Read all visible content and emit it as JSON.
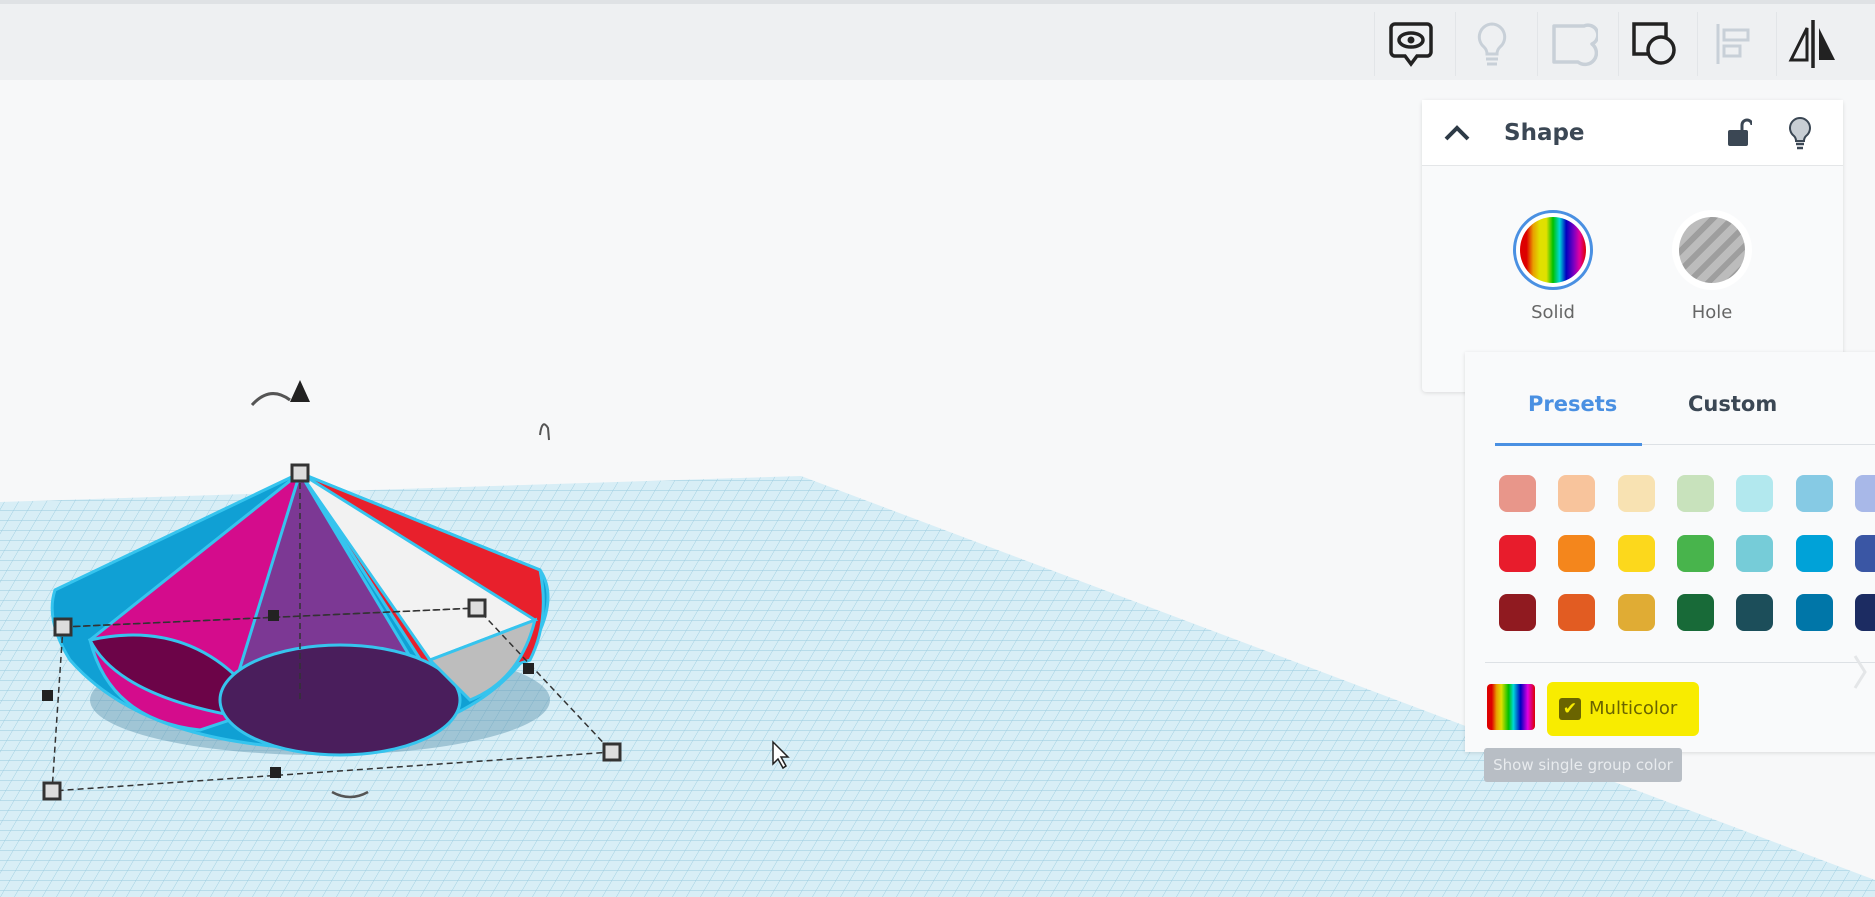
{
  "toolbar": {
    "items": [
      {
        "icon": "show-all-icon",
        "enabled": true
      },
      {
        "icon": "lightbulb-icon",
        "enabled": false
      },
      {
        "icon": "ungroup-icon",
        "enabled": false
      },
      {
        "icon": "group-icon",
        "enabled": true
      },
      {
        "icon": "align-icon",
        "enabled": false
      },
      {
        "icon": "mirror-icon",
        "enabled": true
      }
    ]
  },
  "shape_panel": {
    "title": "Shape",
    "solid_label": "Solid",
    "hole_label": "Hole"
  },
  "color_panel": {
    "tabs": [
      {
        "label": "Presets",
        "active": true
      },
      {
        "label": "Custom",
        "active": false
      }
    ],
    "swatches": [
      [
        "#e8968a",
        "#f8c49c",
        "#f8e2b2",
        "#c8e2bc",
        "#b2e8ee",
        "#86cae4",
        "#a8b8e8"
      ],
      [
        "#e81c2c",
        "#f4861c",
        "#fcd81c",
        "#48b44c",
        "#76ccd8",
        "#00a2d8",
        "#3a56a4"
      ],
      [
        "#901a20",
        "#e25c22",
        "#e0ac34",
        "#186a38",
        "#1c4e5a",
        "#0076a8",
        "#1c2c62"
      ]
    ],
    "multicolor_label": "Multicolor",
    "multicolor_checked": true,
    "tooltip": "Show single group color"
  },
  "colors": {
    "accent": "#4a90e2",
    "highlight": "#f8ec00"
  }
}
